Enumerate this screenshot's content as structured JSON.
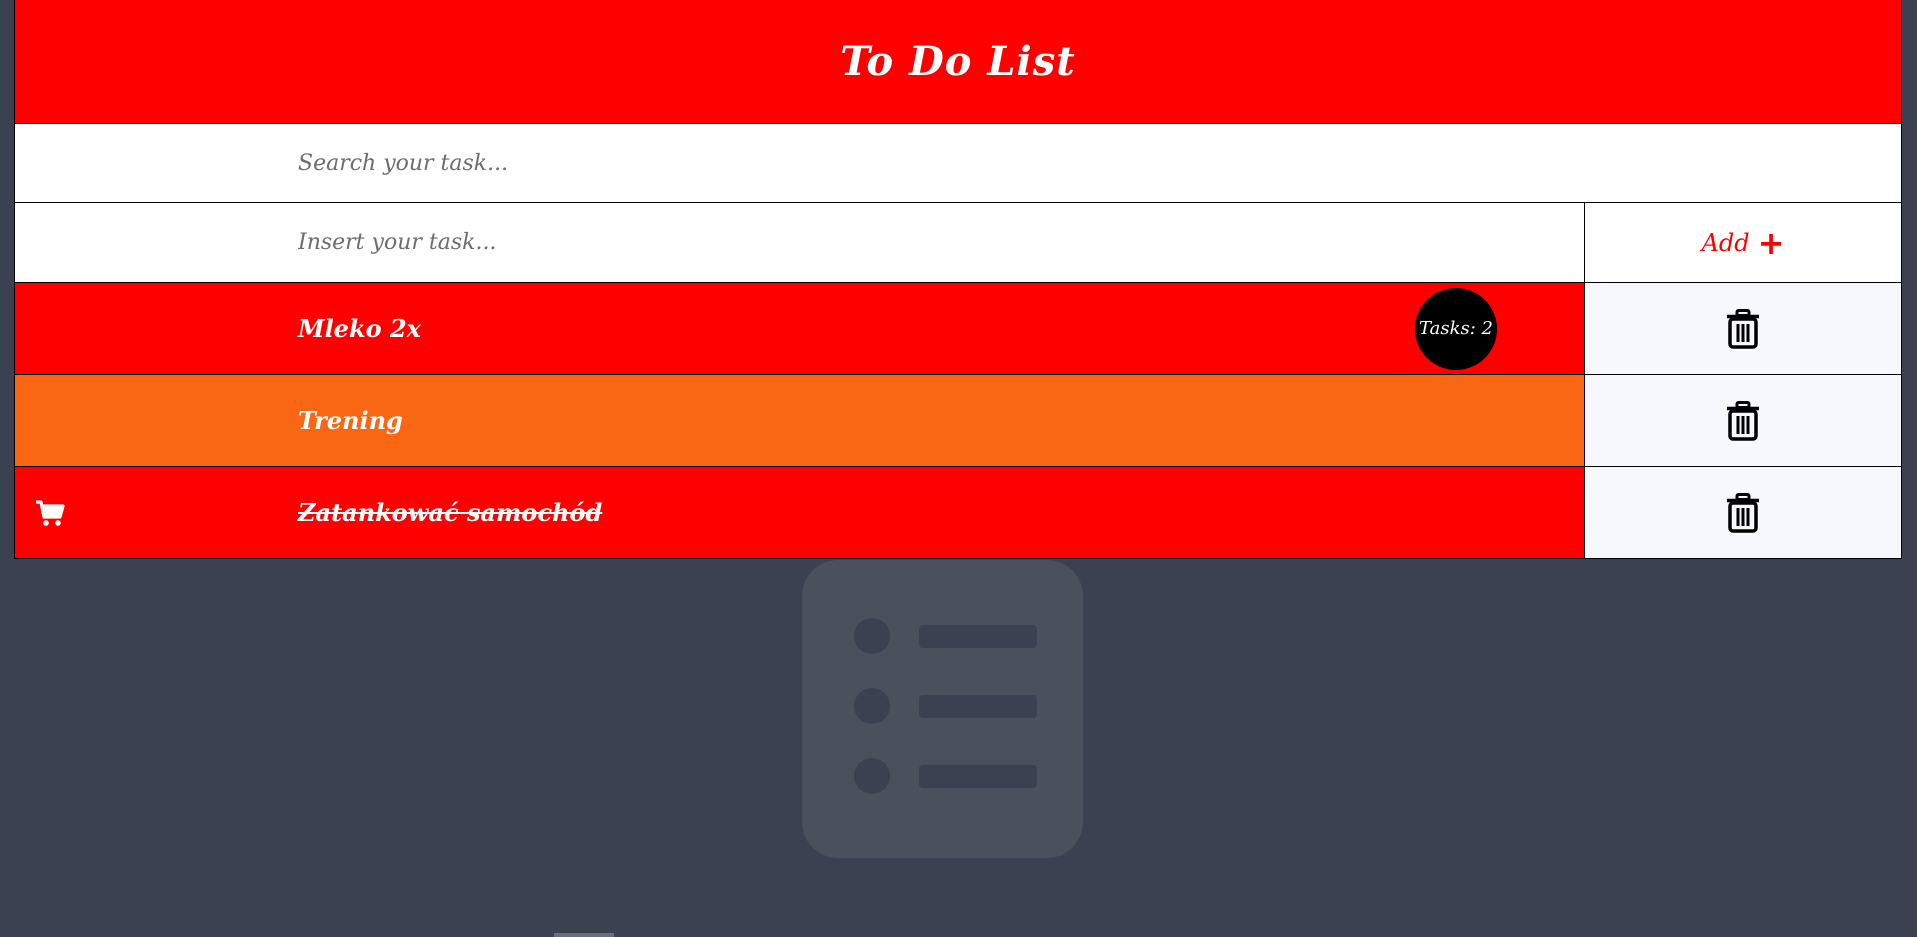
{
  "app": {
    "title": "To Do List"
  },
  "search": {
    "placeholder": "Search your task..."
  },
  "insert": {
    "placeholder": "Insert your task...",
    "add_label": "Add"
  },
  "badge": {
    "label": "Tasks: 2"
  },
  "tasks": [
    {
      "text": "Mleko 2x",
      "color": "#ff0000",
      "done": false,
      "icon": ""
    },
    {
      "text": "Trening",
      "color": "#f96614",
      "done": false,
      "icon": ""
    },
    {
      "text": "Zatankować samochód",
      "color": "#ff0000",
      "done": true,
      "icon": "shopping-cart-icon"
    }
  ],
  "colors": {
    "header": "#ff0000",
    "accent": "#ff0000",
    "page_background": "#3b4150",
    "delete_cell": "#f6f8fe"
  }
}
